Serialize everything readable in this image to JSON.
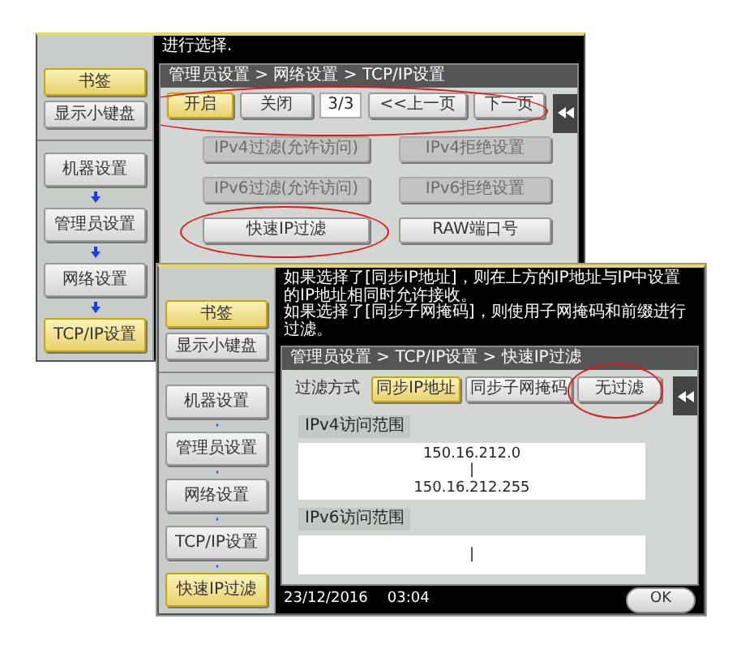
{
  "windows": [
    {
      "sidebar": [
        {
          "kind": "tab",
          "label": "书签",
          "selected": true
        },
        {
          "kind": "tab",
          "label": "显示小键盘",
          "selected": false
        },
        {
          "kind": "step",
          "label": "机器设置",
          "selected": false
        },
        {
          "kind": "step",
          "label": "管理员设置",
          "selected": false
        },
        {
          "kind": "step",
          "label": "网络设置",
          "selected": false
        },
        {
          "kind": "step",
          "label": "TCP/IP设置",
          "selected": true
        }
      ],
      "message": "进行选择.",
      "breadcrumb": "管理员设置 > 网络设置 > TCP/IP设置",
      "toolbar": {
        "circled": true,
        "items": [
          {
            "kind": "toggle",
            "label": "开启",
            "selected": true
          },
          {
            "kind": "toggle",
            "label": "关闭",
            "selected": false
          },
          {
            "kind": "page",
            "label": "3/3"
          },
          {
            "kind": "nav",
            "label": "<<上一页"
          },
          {
            "kind": "nav",
            "label": "下一页"
          }
        ]
      },
      "buttons": [
        {
          "label": "IPv4过滤(允许访问)",
          "disabled": true,
          "circled": false
        },
        {
          "label": "IPv4拒绝设置",
          "disabled": true,
          "circled": false
        },
        {
          "label": "IPv6过滤(允许访问)",
          "disabled": true,
          "circled": false
        },
        {
          "label": "IPv6拒绝设置",
          "disabled": true,
          "circled": false
        },
        {
          "label": "快速IP过滤",
          "disabled": false,
          "circled": true
        },
        {
          "label": "RAW端口号",
          "disabled": false,
          "circled": false
        }
      ]
    },
    {
      "sidebar": [
        {
          "kind": "tab",
          "label": "书签",
          "selected": true
        },
        {
          "kind": "tab",
          "label": "显示小键盘",
          "selected": false
        },
        {
          "kind": "step",
          "label": "机器设置",
          "selected": false
        },
        {
          "kind": "step",
          "label": "管理员设置",
          "selected": false
        },
        {
          "kind": "step",
          "label": "网络设置",
          "selected": false
        },
        {
          "kind": "step",
          "label": "TCP/IP设置",
          "selected": false
        },
        {
          "kind": "step",
          "label": "快速IP过滤",
          "selected": true
        }
      ],
      "message": "如果选择了[同步IP地址]，则在上方的IP地址与IP中设置的IP地址相同时允许接收。",
      "message_2": "如果选择了[同步子网掩码]，则使用子网掩码和前缀进行过滤。",
      "breadcrumb": "管理员设置 > TCP/IP设置 > 快速IP过滤",
      "filter": {
        "label": "过滤方式",
        "options": [
          {
            "label": "同步IP地址",
            "selected": true,
            "circled": false
          },
          {
            "label": "同步子网掩码",
            "selected": false,
            "circled": false
          },
          {
            "label": "无过滤",
            "selected": false,
            "circled": true
          }
        ]
      },
      "sections": [
        {
          "title": "IPv4访问范围",
          "lines": [
            "150.16.212.0",
            "|",
            "150.16.212.255"
          ]
        },
        {
          "title": "IPv6访问范围",
          "lines": [
            "|"
          ]
        }
      ],
      "footer": {
        "date": "23/12/2016",
        "time": "03:04",
        "button": "OK"
      }
    }
  ]
}
